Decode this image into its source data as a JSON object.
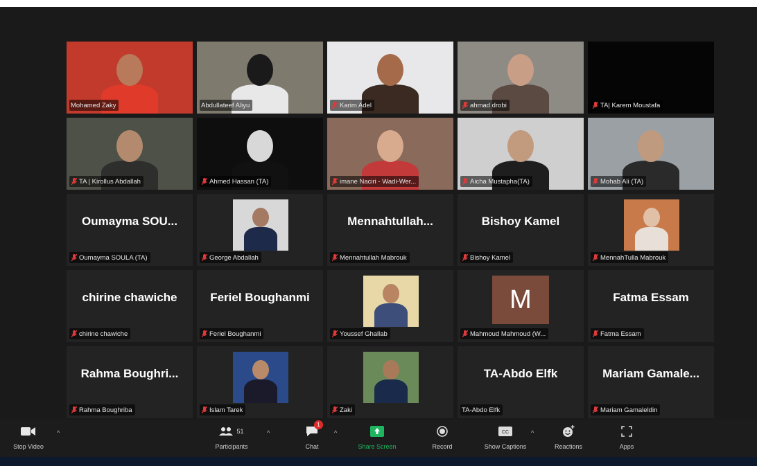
{
  "participants": [
    {
      "label": "Mohamed Zaky",
      "display": "",
      "muted": false,
      "video": true,
      "bg": "#c23a2c",
      "skin": "#b87a5a",
      "shirt": "#e03a2a"
    },
    {
      "label": "Abdullateef Aliyu",
      "display": "",
      "muted": false,
      "video": true,
      "active": true,
      "bg": "#7f7a6e",
      "skin": "#1a1a1a",
      "shirt": "#e8e8e8"
    },
    {
      "label": "Karim Adel",
      "display": "",
      "muted": true,
      "video": true,
      "bg": "#e8e8ea",
      "skin": "#a46a4a",
      "shirt": "#3a2a22"
    },
    {
      "label": "ahmad drobi",
      "display": "",
      "muted": true,
      "video": true,
      "bg": "#8e8a84",
      "skin": "#c89e86",
      "shirt": "#5a4a42"
    },
    {
      "label": "TA| Karem Moustafa",
      "display": "",
      "muted": true,
      "video": true,
      "bg": "#050505",
      "skin": "#050505",
      "shirt": "#050505"
    },
    {
      "label": "TA | Kirollus Abdallah",
      "display": "",
      "muted": true,
      "video": true,
      "bg": "#4e5148",
      "skin": "#b48a6e",
      "shirt": "#2e2e2c"
    },
    {
      "label": "Ahmed Hassan (TA)",
      "display": "",
      "muted": true,
      "video": true,
      "bg": "#0e0e0e",
      "skin": "#d8d8d8",
      "shirt": "#111"
    },
    {
      "label": "imane Naciri - Wadi-Wer...",
      "display": "",
      "muted": true,
      "video": true,
      "bg": "#8a6a5a",
      "skin": "#d8aa8e",
      "shirt": "#c23a3a"
    },
    {
      "label": "Aicha Mustapha(TA)",
      "display": "",
      "muted": true,
      "video": true,
      "bg": "#cfcfcf",
      "skin": "#c29a7e",
      "shirt": "#1e1e1e"
    },
    {
      "label": "Mohab Ali (TA)",
      "display": "",
      "muted": true,
      "video": true,
      "bg": "#9aa0a4",
      "skin": "#c09a7e",
      "shirt": "#2a2a2a"
    },
    {
      "label": "Oumayma SOULA (TA)",
      "display": "Oumayma  SOU...",
      "muted": true,
      "video": false
    },
    {
      "label": "George Abdallah",
      "display": "",
      "muted": true,
      "video": "photo",
      "bg": "#d8d8d8",
      "skin": "#a47a62",
      "shirt": "#1e2a4a"
    },
    {
      "label": "Mennahtullah Mabrouk",
      "display": "Mennahtullah...",
      "muted": true,
      "video": false
    },
    {
      "label": "Bishoy Kamel",
      "display": "Bishoy Kamel",
      "muted": true,
      "video": false
    },
    {
      "label": "MennahTulla Mabrouk",
      "display": "",
      "muted": true,
      "video": "photo",
      "bg": "#c87a4a",
      "skin": "#e0c0a6",
      "shirt": "#e8e0d8"
    },
    {
      "label": "chirine chawiche",
      "display": "chirine chawiche",
      "muted": true,
      "video": false
    },
    {
      "label": "Feriel Boughanmi",
      "display": "Feriel Boughanmi",
      "muted": true,
      "video": false
    },
    {
      "label": "Youssef Ghallab",
      "display": "",
      "muted": true,
      "video": "photo",
      "bg": "#e8d8a8",
      "skin": "#b88462",
      "shirt": "#3e4e7a"
    },
    {
      "label": "Mahmoud Mahmoud (W...",
      "display": "",
      "muted": true,
      "video": "letter",
      "letter": "M"
    },
    {
      "label": "Fatma Essam",
      "display": "Fatma Essam",
      "muted": true,
      "video": false
    },
    {
      "label": "Rahma Boughriba",
      "display": "Rahma  Boughri...",
      "muted": true,
      "video": false
    },
    {
      "label": "Islam Tarek",
      "display": "",
      "muted": true,
      "video": "photo",
      "bg": "#2a4a8a",
      "skin": "#b88a6a",
      "shirt": "#1a1a2a"
    },
    {
      "label": "Zaki",
      "display": "",
      "muted": true,
      "video": "photo",
      "bg": "#6a8a5a",
      "skin": "#a87a5a",
      "shirt": "#1a2a4a"
    },
    {
      "label": "TA-Abdo Elfk",
      "display": "TA-Abdo Elfk",
      "muted": false,
      "video": false
    },
    {
      "label": "Mariam Gamaleldin",
      "display": "Mariam  Gamale...",
      "muted": true,
      "video": false
    }
  ],
  "toolbar": {
    "stop_video": "Stop Video",
    "participants": "Participants",
    "participants_count": "51",
    "chat": "Chat",
    "chat_badge": "1",
    "share_screen": "Share Screen",
    "record": "Record",
    "show_captions": "Show Captions",
    "reactions": "Reactions",
    "apps": "Apps"
  },
  "colors": {
    "active_speaker": "#d6e85c",
    "share_green": "#1fb560",
    "muted_red": "#e03a3a"
  }
}
